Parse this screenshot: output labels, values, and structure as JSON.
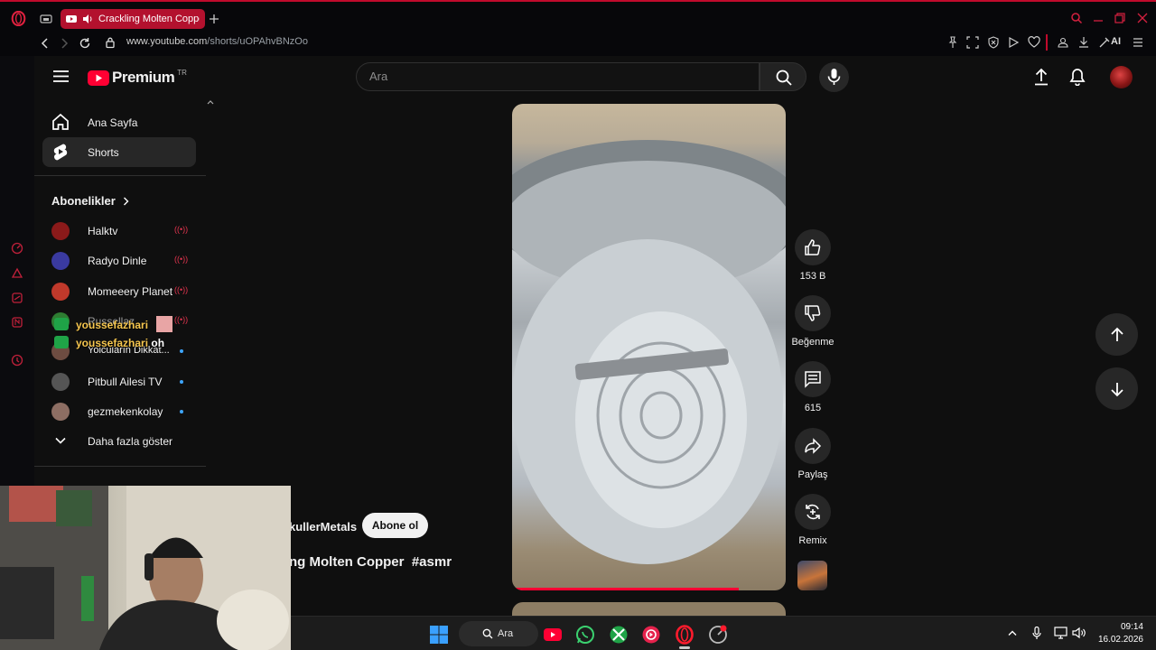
{
  "browser": {
    "tab_title": "Crackling Molten Copper",
    "url_domain": "www.youtube.com",
    "url_path": "/shorts/uOPAhvBNzOo",
    "ai_label": "AI"
  },
  "youtube": {
    "logo_text": "Premium",
    "logo_region": "TR",
    "search_placeholder": "Ara",
    "nav": {
      "home": "Ana Sayfa",
      "shorts": "Shorts",
      "subscriptions_title": "Abonelikler",
      "show_more": "Daha fazla göster"
    },
    "subscriptions": [
      {
        "name": "Halktv",
        "status": "live",
        "color": "#8b1a1a"
      },
      {
        "name": "Radyo Dinle",
        "status": "live",
        "color": "#3a3aa0"
      },
      {
        "name": "Momeeery Planet",
        "status": "live",
        "color": "#c0392b"
      },
      {
        "name": "Russellaz",
        "status": "live",
        "color": "#2e7d32"
      },
      {
        "name": "Yolcuların Dikkat...",
        "status": "new",
        "color": "#6d4c41"
      },
      {
        "name": "Pitbull Ailesi TV",
        "status": "new",
        "color": "#555555"
      },
      {
        "name": "gezmekenkolay",
        "status": "new",
        "color": "#8d6e63"
      }
    ],
    "live_glyph": "((•))",
    "short": {
      "channel": "kullerMetals",
      "subscribe_label": "Abone ol",
      "title": "ng Molten Copper",
      "hashtag": "#asmr",
      "progress": 0.83,
      "actions": {
        "likes": "153 B",
        "dislike": "Beğenme",
        "comments": "615",
        "share": "Paylaş",
        "remix": "Remix"
      }
    }
  },
  "chat_overlay": [
    {
      "user": "youssefazhari",
      "message": ""
    },
    {
      "user": "youssefazhari",
      "message": "oh"
    }
  ],
  "taskbar": {
    "search_label": "Ara",
    "time": "09:14",
    "date": "16.02.2026"
  },
  "colors": {
    "accent_red": "#ff0033",
    "opera_red": "#c00a2c",
    "background": "#0f0f0f"
  }
}
